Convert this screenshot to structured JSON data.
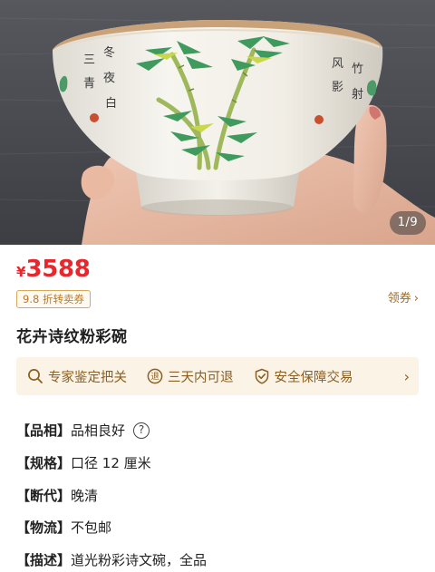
{
  "gallery": {
    "counter": "1/9"
  },
  "price": {
    "currency": "¥",
    "amount": "3588",
    "accent": "#e8262b"
  },
  "coupon": {
    "tag": "9.8 折转卖券",
    "action": "领券"
  },
  "item": {
    "title": "花卉诗纹粉彩碗"
  },
  "guarantees": [
    {
      "icon": "search-icon",
      "label": "专家鉴定把关"
    },
    {
      "icon": "return-icon",
      "label": "三天内可退"
    },
    {
      "icon": "shield-check-icon",
      "label": "安全保障交易"
    }
  ],
  "attributes": [
    {
      "key": "【品相】",
      "value": "品相良好",
      "help": "?"
    },
    {
      "key": "【规格】",
      "value": "口径 12 厘米"
    },
    {
      "key": "【断代】",
      "value": "晚清"
    },
    {
      "key": "【物流】",
      "value": "不包邮"
    },
    {
      "key": "【描述】",
      "value": "道光粉彩诗文碗，全品"
    }
  ],
  "bowl_inscription": [
    "三",
    "冬",
    "青",
    "夜",
    "白",
    "风",
    "竹",
    "影",
    "射"
  ]
}
